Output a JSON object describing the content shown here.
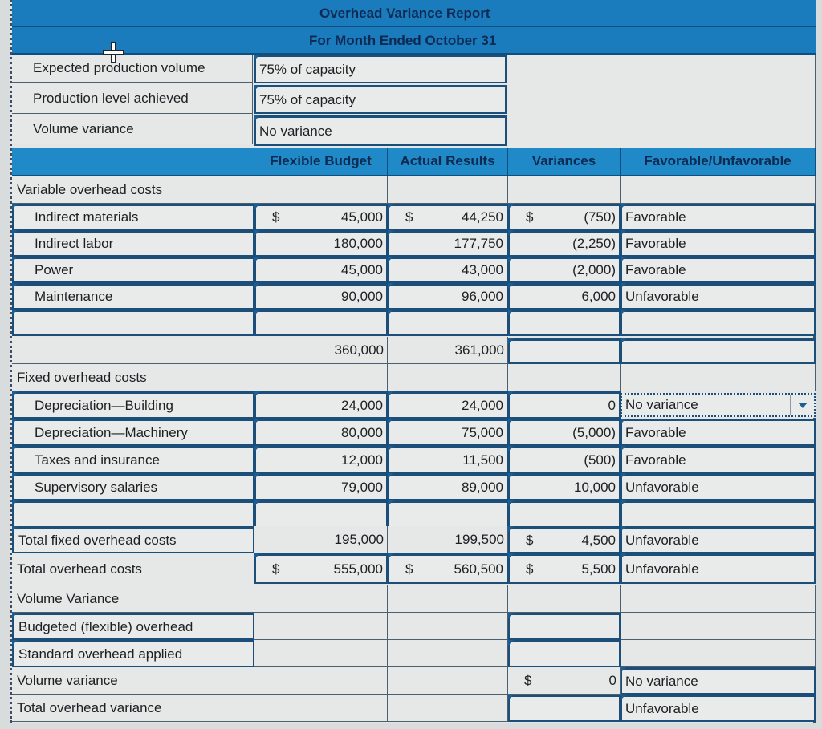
{
  "report": {
    "title": "Overhead Variance Report",
    "subtitle": "For Month Ended October 31"
  },
  "info_rows": [
    {
      "label": "Expected production volume",
      "value": "75% of capacity"
    },
    {
      "label": "Production level achieved",
      "value": "75% of capacity"
    },
    {
      "label": "Volume variance",
      "value": "No variance"
    }
  ],
  "columns": {
    "flexible_budget": "Flexible Budget",
    "actual_results": "Actual Results",
    "variances": "Variances",
    "fav_unfav": "Favorable/Unfavorable"
  },
  "variable": {
    "heading": "Variable overhead costs",
    "rows": [
      {
        "label": "Indirect materials",
        "budget_cur": "$",
        "budget": "45,000",
        "actual_cur": "$",
        "actual": "44,250",
        "var_cur": "$",
        "variance": "(750)",
        "fu": "Favorable"
      },
      {
        "label": "Indirect labor",
        "budget_cur": "",
        "budget": "180,000",
        "actual_cur": "",
        "actual": "177,750",
        "var_cur": "",
        "variance": "(2,250)",
        "fu": "Favorable"
      },
      {
        "label": "Power",
        "budget_cur": "",
        "budget": "45,000",
        "actual_cur": "",
        "actual": "43,000",
        "var_cur": "",
        "variance": "(2,000)",
        "fu": "Favorable"
      },
      {
        "label": "Maintenance",
        "budget_cur": "",
        "budget": "90,000",
        "actual_cur": "",
        "actual": "96,000",
        "var_cur": "",
        "variance": "6,000",
        "fu": "Unfavorable"
      },
      {
        "label": "",
        "budget_cur": "",
        "budget": "",
        "actual_cur": "",
        "actual": "",
        "var_cur": "",
        "variance": "",
        "fu": ""
      }
    ],
    "total": {
      "label": "",
      "budget": "360,000",
      "actual": "361,000",
      "variance": "",
      "fu": ""
    }
  },
  "fixed": {
    "heading": "Fixed overhead costs",
    "rows": [
      {
        "label": "Depreciation—Building",
        "budget": "24,000",
        "actual": "24,000",
        "variance": "0",
        "fu": "No variance"
      },
      {
        "label": "Depreciation—Machinery",
        "budget": "80,000",
        "actual": "75,000",
        "variance": "(5,000)",
        "fu": "Favorable"
      },
      {
        "label": "Taxes and insurance",
        "budget": "12,000",
        "actual": "11,500",
        "variance": "(500)",
        "fu": "Favorable"
      },
      {
        "label": "Supervisory salaries",
        "budget": "79,000",
        "actual": "89,000",
        "variance": "10,000",
        "fu": "Unfavorable"
      },
      {
        "label": "",
        "budget": "",
        "actual": "",
        "variance": "",
        "fu": ""
      }
    ]
  },
  "totals": {
    "fixed": {
      "label": "Total fixed overhead costs",
      "budget": "195,000",
      "actual": "199,500",
      "var_cur": "$",
      "variance": "4,500",
      "fu": "Unfavorable"
    },
    "overhead": {
      "label": "Total overhead costs",
      "budget_cur": "$",
      "budget": "555,000",
      "actual_cur": "$",
      "actual": "560,500",
      "var_cur": "$",
      "variance": "5,500",
      "fu": "Unfavorable"
    }
  },
  "volume_section": {
    "heading": "Volume Variance",
    "budgeted_label": "Budgeted (flexible) overhead",
    "budgeted_value": "",
    "applied_label": "Standard overhead applied",
    "applied_value": "",
    "volume_label": "Volume variance",
    "volume_cur": "$",
    "volume_value": "0",
    "volume_fu": "No variance",
    "total_label": "Total overhead variance",
    "total_value": "",
    "total_fu": "Unfavorable"
  }
}
